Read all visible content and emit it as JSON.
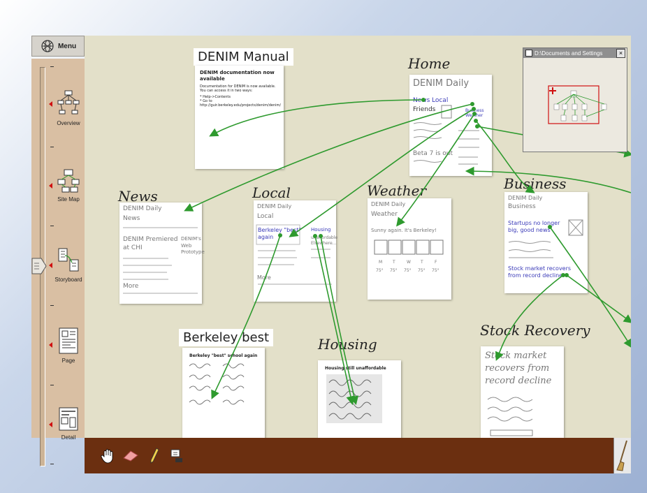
{
  "menu": {
    "label": "Menu"
  },
  "zoom_levels": [
    {
      "label": "Overview",
      "icon": "overview-icon"
    },
    {
      "label": "Site Map",
      "icon": "site-map-icon"
    },
    {
      "label": "Storyboard",
      "icon": "storyboard-icon"
    },
    {
      "label": "Page",
      "icon": "page-icon"
    },
    {
      "label": "Detail",
      "icon": "detail-icon"
    }
  ],
  "pages": {
    "manual": {
      "label": "DENIM Manual",
      "line1": "DENIM documentation now",
      "line2": "available",
      "line3": "Documentation for DENIM is now available.",
      "line4": "You can access it in two ways:",
      "line5": "* Help->Contents",
      "line6": "* Go to http://guir.berkeley.edu/projects/denim/denim/"
    },
    "home": {
      "label": "Home",
      "title": "DENIM Daily",
      "news": "News",
      "local": "Local",
      "business": "Business",
      "weather": "Weather",
      "friends": "Friends",
      "beta": "Beta 7 is out"
    },
    "news": {
      "label": "News",
      "t1": "DENIM Daily",
      "t2": "News",
      "t3": "DENIM Premiered",
      "t4": "at CHI",
      "t5": "DENIM's",
      "t6": "Web",
      "t7": "Prototype",
      "t8": "More"
    },
    "local": {
      "label": "Local",
      "t1": "DENIM Daily",
      "t2": "Local",
      "t3": "Berkeley \"best\"",
      "t4": "again",
      "t5": "Housing",
      "t6": "unaffordable",
      "t7": "Elsewhere...",
      "t8": "More"
    },
    "weather": {
      "label": "Weather",
      "t1": "DENIM Daily",
      "t2": "Weather",
      "t3": "Sunny again. It's Berkeley!",
      "days": [
        "M",
        "T",
        "W",
        "T",
        "F"
      ],
      "temps": [
        "75°",
        "75°",
        "75°",
        "75°",
        "75°"
      ]
    },
    "business": {
      "label": "Business",
      "t1": "DENIM Daily",
      "t2": "Business",
      "t3": "Startups no longer",
      "t4": "big, good news",
      "t5": "Stock market recovers",
      "t6": "from record decline"
    },
    "berkeley": {
      "label": "Berkeley best",
      "t1": "Berkeley \"best\" school again"
    },
    "housing": {
      "label": "Housing",
      "t1": "Housing still unaffordable"
    },
    "stock": {
      "label": "Stock Recovery",
      "t1": "Stock market",
      "t2": "recovers from",
      "t3": "record decline"
    }
  },
  "radar": {
    "title": "D:\\Documents and Settings",
    "close": "×"
  },
  "toolbar": {
    "tools": [
      "hand-tool",
      "eraser-tool",
      "pencil-tool",
      "insert-component-tool"
    ],
    "trash": "broom-icon"
  },
  "colors": {
    "canvas": "#e3e0c9",
    "arrow": "#2e9a2e",
    "sidebar": "#d9bfa3",
    "toolbar": "#6b2f10",
    "ink_blue": "#3a3ab8"
  }
}
